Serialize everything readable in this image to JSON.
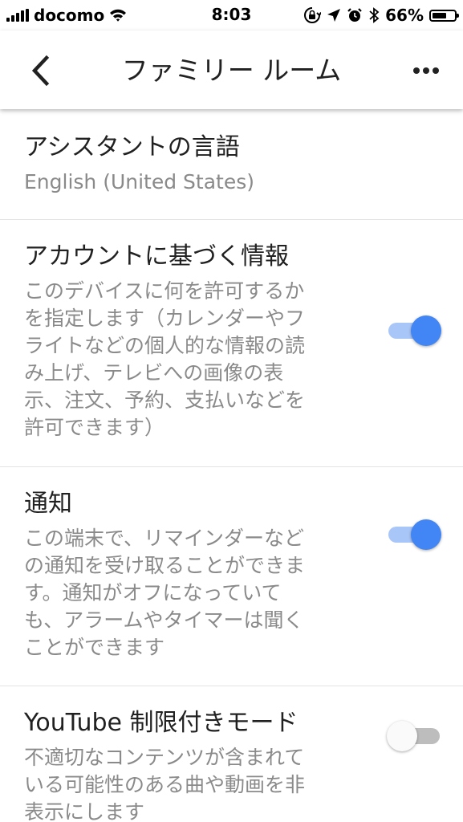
{
  "status_bar": {
    "carrier": "docomo",
    "time": "8:03",
    "battery_percent": "66%",
    "battery_level": 0.66,
    "icons": [
      "signal-icon",
      "wifi-icon",
      "rotation-lock-icon",
      "location-icon",
      "alarm-icon",
      "bluetooth-icon",
      "battery-icon"
    ]
  },
  "app_bar": {
    "title": "ファミリー ルーム",
    "back_icon": "chevron-left-icon",
    "menu_icon": "more-horizontal-icon"
  },
  "settings": {
    "language": {
      "title": "アシスタントの言語",
      "value": "English (United States)"
    },
    "account_info": {
      "title": "アカウントに基づく情報",
      "description": "このデバイスに何を許可するか\nを指定します（カレンダーやフ\nライトなどの個人的な情報の読\nみ上げ、テレビへの画像の表\n示、注文、予約、支払いなどを\n許可できます）",
      "enabled": true
    },
    "notifications": {
      "title": "通知",
      "description": "この端末で、リマインダーなど\nの通知を受け取ることができま\nす。通知がオフになっていて\nも、アラームやタイマーは聞く\nことができます",
      "enabled": true
    },
    "youtube_restricted": {
      "title": "YouTube 制限付きモード",
      "description": "不適切なコンテンツが含まれて\nいる可能性のある曲や動画を非\n表示にします",
      "enabled": false
    }
  },
  "colors": {
    "toggle_on_thumb": "#4285f4",
    "toggle_on_track": "#a9c6f9",
    "toggle_off_thumb": "#fafafa",
    "toggle_off_track": "#bdbdbd",
    "title_text": "#212121",
    "secondary_text": "#8a8a8a",
    "divider": "#e3e3e3"
  }
}
